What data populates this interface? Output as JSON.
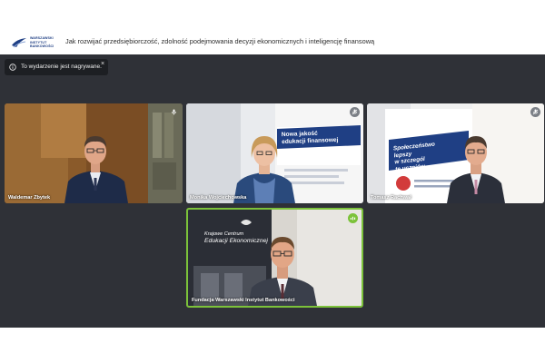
{
  "header": {
    "logo_lines": [
      "WARSZAWSKI",
      "INSTYTUT",
      "BANKOWOŚCI"
    ],
    "title": "Jak rozwijać przedsiębiorczość, zdolność podejmowania decyzji ekonomicznych i inteligencję finansową"
  },
  "recording_banner": {
    "text": "To wydarzenie jest nagrywane.",
    "close_label": "×"
  },
  "participants": [
    {
      "name": "Waldemar Zbytek",
      "badge": "mic-icon"
    },
    {
      "name": "Monika Wojciechowska",
      "badge": "mic-off-icon"
    },
    {
      "name": "Tomasz Rachwał",
      "badge": "mic-off-icon"
    },
    {
      "name": "Fundacja Warszawski Instytut Bankowości",
      "badge": "speaking-indicator"
    }
  ],
  "backgrounds": {
    "tile2_poster_lines": [
      "Nowa jakość",
      "edukacji finansowej"
    ],
    "tile3_poster_lines": [
      "Społeczeństwo",
      "lepszy",
      "w szczegól",
      "te uczniów"
    ],
    "tile4_poster_lines": [
      "Krajowe Centrum",
      "Edukacji Ekonomicznej"
    ]
  },
  "colors": {
    "stage": "#2f3137",
    "speaking": "#7cc23a",
    "brand": "#1f3f84"
  }
}
